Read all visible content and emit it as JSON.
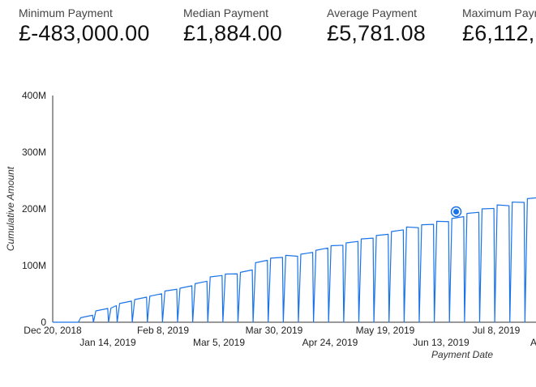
{
  "scorecards": [
    {
      "label": "Minimum Payment",
      "value": "£-483,000.00"
    },
    {
      "label": "Median Payment",
      "value": "£1,884.00"
    },
    {
      "label": "Average Payment",
      "value": "£5,781.08"
    },
    {
      "label": "Maximum Payment",
      "value": "£6,112,"
    }
  ],
  "chart_data": {
    "type": "line",
    "xlabel": "Payment Date",
    "ylabel": "Cumulative Amount",
    "ylim": [
      0,
      400000000
    ],
    "y_ticks": [
      "0",
      "100M",
      "200M",
      "300M",
      "400M"
    ],
    "x_ticks_upper": [
      "Dec 20, 2018",
      "Feb 8, 2019",
      "Mar 30, 2019",
      "May 19, 2019",
      "Jul 8, 2019"
    ],
    "x_ticks_lower": [
      "Jan 14, 2019",
      "Mar 5, 2019",
      "Apr 24, 2019",
      "Jun 13, 2019",
      "Au"
    ],
    "x_start": "2018-12-20",
    "series_color": "#1a73e8",
    "highlight_point": {
      "date": "2019-06-25",
      "value": 195000000
    },
    "monthly_peaks_M": [
      [
        "2019-01-02",
        8
      ],
      [
        "2019-01-09",
        20
      ],
      [
        "2019-01-16",
        25
      ],
      [
        "2019-01-20",
        33
      ],
      [
        "2019-01-27",
        40
      ],
      [
        "2019-02-03",
        46
      ],
      [
        "2019-02-10",
        55
      ],
      [
        "2019-02-17",
        60
      ],
      [
        "2019-02-24",
        68
      ],
      [
        "2019-03-03",
        80
      ],
      [
        "2019-03-10",
        85
      ],
      [
        "2019-03-17",
        88
      ],
      [
        "2019-03-24",
        105
      ],
      [
        "2019-03-31",
        113
      ],
      [
        "2019-04-07",
        118
      ],
      [
        "2019-04-14",
        120
      ],
      [
        "2019-04-21",
        127
      ],
      [
        "2019-04-28",
        135
      ],
      [
        "2019-05-05",
        140
      ],
      [
        "2019-05-12",
        147
      ],
      [
        "2019-05-19",
        153
      ],
      [
        "2019-05-26",
        160
      ],
      [
        "2019-06-02",
        168
      ],
      [
        "2019-06-09",
        172
      ],
      [
        "2019-06-16",
        178
      ],
      [
        "2019-06-23",
        183
      ],
      [
        "2019-06-30",
        192
      ],
      [
        "2019-07-07",
        200
      ],
      [
        "2019-07-14",
        207
      ],
      [
        "2019-07-21",
        212
      ],
      [
        "2019-07-28",
        218
      ]
    ]
  }
}
